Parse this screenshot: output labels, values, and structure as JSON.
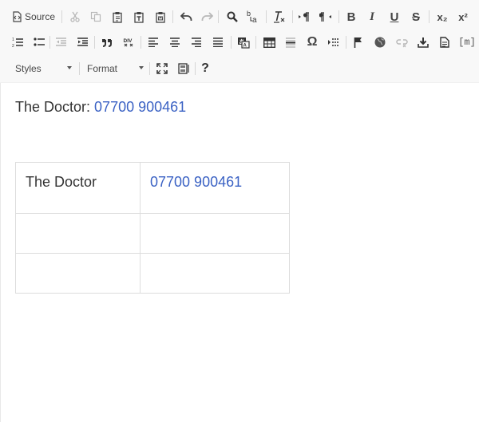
{
  "toolbar": {
    "source_label": "Source",
    "styles_label": "Styles",
    "format_label": "Format",
    "help_glyph": "?",
    "row1": [
      {
        "name": "cut-icon",
        "glyph": "✂"
      },
      {
        "name": "copy-icon",
        "glyph": "⎘"
      },
      {
        "name": "paste-icon",
        "glyph": "📋"
      },
      {
        "name": "paste-text-icon",
        "glyph": "T"
      },
      {
        "name": "paste-word-icon",
        "glyph": "W"
      },
      {
        "name": "undo-icon",
        "glyph": "↶"
      },
      {
        "name": "redo-icon",
        "glyph": "↷"
      },
      {
        "name": "find-icon",
        "glyph": "⌕"
      },
      {
        "name": "replace-icon",
        "glyph": "b→a"
      },
      {
        "name": "remove-format-icon",
        "glyph": "Ix"
      },
      {
        "name": "ltr-icon",
        "glyph": "¶"
      },
      {
        "name": "rtl-icon",
        "glyph": "¶"
      },
      {
        "name": "bold-icon",
        "glyph": "B"
      },
      {
        "name": "italic-icon",
        "glyph": "I"
      },
      {
        "name": "underline-icon",
        "glyph": "U"
      },
      {
        "name": "strike-icon",
        "glyph": "S"
      },
      {
        "name": "subscript-icon",
        "glyph": "x₂"
      },
      {
        "name": "superscript-icon",
        "glyph": "x²"
      }
    ],
    "code_snippet_glyph": "[m]"
  },
  "editor": {
    "line_label": "The Doctor: ",
    "line_phone": "07700 900461",
    "table": {
      "rows": [
        [
          "The Doctor",
          "07700 900461"
        ],
        [
          "",
          ""
        ],
        [
          "",
          ""
        ]
      ]
    }
  },
  "colors": {
    "link": "#3b62c4",
    "toolbar_bg": "#f8f8f8",
    "icon": "#444444",
    "icon_disabled": "#b8b8b8"
  }
}
